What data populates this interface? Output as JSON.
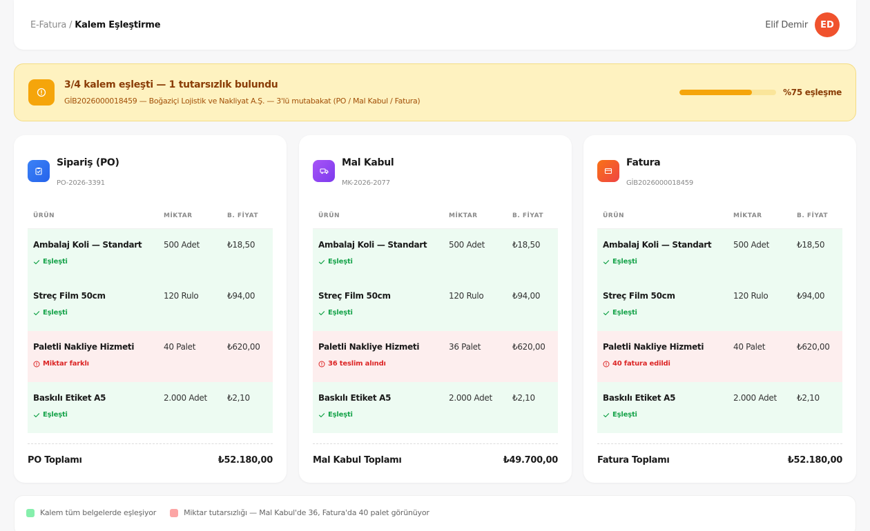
{
  "breadcrumb": {
    "root": "E-Fatura",
    "separator": "/",
    "current": "Kalem Eşleştirme"
  },
  "user": {
    "name": "Elif Demir",
    "initials": "ED"
  },
  "alert": {
    "title": "3/4 kalem eşleşti — 1 tutarsızlık bulundu",
    "subtitle": "GİB2026000018459 — Boğaziçi Lojistik ve Nakliyat A.Ş. — 3'lü mutabakat (PO / Mal Kabul / Fatura)",
    "match_percent": 75,
    "match_label": "%75 eşleşme"
  },
  "columns": {
    "product": "ÜRÜN",
    "quantity": "MİKTAR",
    "unit_price": "B. FİYAT"
  },
  "cards": [
    {
      "title": "Sipariş (PO)",
      "doc_no": "PO-2026-3391",
      "icon": "clipboard-check-icon",
      "rows": [
        {
          "product": "Ambalaj Koli — Standart",
          "qty": "500 Adet",
          "price": "₺18,50",
          "status": "Eşleşti",
          "ok": true
        },
        {
          "product": "Streç Film 50cm",
          "qty": "120 Rulo",
          "price": "₺94,00",
          "status": "Eşleşti",
          "ok": true
        },
        {
          "product": "Paletli Nakliye Hizmeti",
          "qty": "40 Palet",
          "price": "₺620,00",
          "status": "Miktar farklı",
          "ok": false
        },
        {
          "product": "Baskılı Etiket A5",
          "qty": "2.000 Adet",
          "price": "₺2,10",
          "status": "Eşleşti",
          "ok": true
        }
      ],
      "total_label": "PO Toplamı",
      "total_value": "₺52.180,00"
    },
    {
      "title": "Mal Kabul",
      "doc_no": "MK-2026-2077",
      "icon": "truck-icon",
      "rows": [
        {
          "product": "Ambalaj Koli — Standart",
          "qty": "500 Adet",
          "price": "₺18,50",
          "status": "Eşleşti",
          "ok": true
        },
        {
          "product": "Streç Film 50cm",
          "qty": "120 Rulo",
          "price": "₺94,00",
          "status": "Eşleşti",
          "ok": true
        },
        {
          "product": "Paletli Nakliye Hizmeti",
          "qty": "36 Palet",
          "price": "₺620,00",
          "status": "36 teslim alındı",
          "ok": false
        },
        {
          "product": "Baskılı Etiket A5",
          "qty": "2.000 Adet",
          "price": "₺2,10",
          "status": "Eşleşti",
          "ok": true
        }
      ],
      "total_label": "Mal Kabul Toplamı",
      "total_value": "₺49.700,00"
    },
    {
      "title": "Fatura",
      "doc_no": "GİB2026000018459",
      "icon": "receipt-icon",
      "rows": [
        {
          "product": "Ambalaj Koli — Standart",
          "qty": "500 Adet",
          "price": "₺18,50",
          "status": "Eşleşti",
          "ok": true
        },
        {
          "product": "Streç Film 50cm",
          "qty": "120 Rulo",
          "price": "₺94,00",
          "status": "Eşleşti",
          "ok": true
        },
        {
          "product": "Paletli Nakliye Hizmeti",
          "qty": "40 Palet",
          "price": "₺620,00",
          "status": "40 fatura edildi",
          "ok": false
        },
        {
          "product": "Baskılı Etiket A5",
          "qty": "2.000 Adet",
          "price": "₺2,10",
          "status": "Eşleşti",
          "ok": true
        }
      ],
      "total_label": "Fatura Toplamı",
      "total_value": "₺52.180,00"
    }
  ],
  "legend": {
    "match": "Kalem tüm belgelerde eşleşiyor",
    "mismatch": "Miktar tutarsızlığı — Mal Kabul'de 36, Fatura'da 40 palet görünüyor"
  },
  "colors": {
    "po_icon": "#3b82f6",
    "mk_icon": "#8b5cf6",
    "invoice_icon": "#f04e2d",
    "match": "#86efac",
    "mismatch": "#fca5a5",
    "warning": "#f5a50b"
  }
}
